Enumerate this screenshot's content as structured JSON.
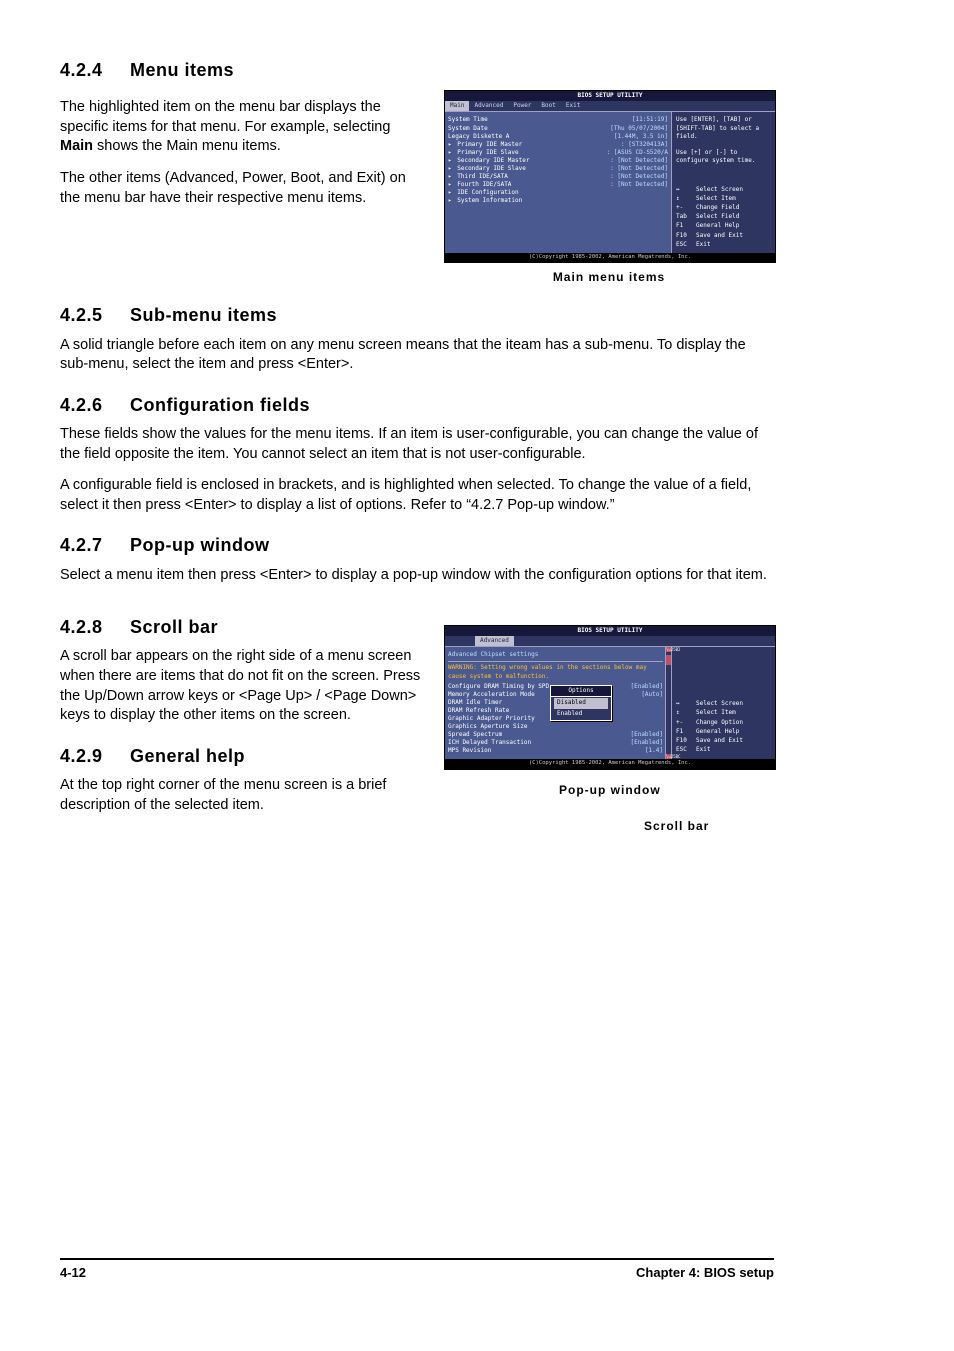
{
  "sections": {
    "s424": {
      "num": "4.2.4",
      "title": "Menu items",
      "p1": "The highlighted item on the menu bar  displays the specific items for that menu. For example, selecting ",
      "p1bold": "Main",
      "p1cont": " shows the Main menu items.",
      "p2": "The other items (Advanced, Power, Boot, and Exit) on the menu bar have their respective menu items.",
      "figcap": "Main menu items"
    },
    "s425": {
      "num": "4.2.5",
      "title": "Sub-menu items",
      "p1": "A solid triangle before each item on any menu screen means that the iteam has a sub-menu. To display the sub-menu, select the item and press <Enter>."
    },
    "s426": {
      "num": "4.2.6",
      "title": "Configuration fields",
      "p1": "These fields show the values for the menu items. If an item is user-configurable, you can change the value of the field opposite the item. You cannot select an item that is not user-configurable.",
      "p2": "A configurable field is enclosed in brackets, and is highlighted when selected. To change the value of a field, select it then press <Enter> to display a list of options. Refer to “4.2.7 Pop-up window.”"
    },
    "s427": {
      "num": "4.2.7",
      "title": "Pop-up window",
      "p1": "Select a menu item then press <Enter> to display a pop-up window with the configuration options for that item."
    },
    "s428": {
      "num": "4.2.8",
      "title": "Scroll bar",
      "p1": "A scroll bar appears on the right side of a menu screen when there are items that do not fit on the screen. Press the Up/Down arrow keys or <Page Up> / <Page Down> keys to display the other items on the screen."
    },
    "s429": {
      "num": "4.2.9",
      "title": "General help",
      "p1": "At the top right corner of the menu screen is a brief description of the selected item."
    }
  },
  "bios1": {
    "title": "BIOS SETUP UTILITY",
    "menu": [
      "Main",
      "Advanced",
      "Power",
      "Boot",
      "Exit"
    ],
    "items": [
      {
        "lbl": "System Time",
        "val": "[11:51:19]",
        "tri": false
      },
      {
        "lbl": "System Date",
        "val": "[Thu 05/07/2004]",
        "tri": false
      },
      {
        "lbl": "Legacy Diskette A",
        "val": "[1.44M, 3.5 in]",
        "tri": false
      },
      {
        "lbl": "",
        "val": "",
        "tri": false
      },
      {
        "lbl": " Primary IDE Master",
        "val": ": [ST320413A]",
        "tri": true
      },
      {
        "lbl": " Primary IDE Slave",
        "val": ": [ASUS CD-S520/A",
        "tri": true
      },
      {
        "lbl": " Secondary IDE Master",
        "val": ": [Not Detected]",
        "tri": true
      },
      {
        "lbl": " Secondary IDE Slave",
        "val": ": [Not Detected]",
        "tri": true
      },
      {
        "lbl": " Third IDE/SATA",
        "val": ": [Not Detected]",
        "tri": true
      },
      {
        "lbl": " Fourth IDE/SATA",
        "val": ": [Not Detected]",
        "tri": true
      },
      {
        "lbl": " IDE Configuration",
        "val": "",
        "tri": true
      },
      {
        "lbl": "",
        "val": "",
        "tri": false
      },
      {
        "lbl": " System Information",
        "val": "",
        "tri": true
      }
    ],
    "help_top": "Use [ENTER], [TAB] or [SHIFT-TAB] to select a field.\n\nUse [+] or [-] to configure system time.",
    "help_keys": [
      [
        "↔",
        "Select Screen"
      ],
      [
        "↕",
        "Select Item"
      ],
      [
        "+-",
        "Change Field"
      ],
      [
        "Tab",
        "Select Field"
      ],
      [
        "F1",
        "General Help"
      ],
      [
        "F10",
        "Save and Exit"
      ],
      [
        "ESC",
        "Exit"
      ]
    ],
    "footer": "(C)Copyright 1985-2002, American Megatrends, Inc."
  },
  "bios2": {
    "title": "BIOS SETUP UTILITY",
    "menu": [
      "Advanced"
    ],
    "heading": "Advanced Chipset settings",
    "warning": "WARNING: Setting wrong values in the sections below may cause system to malfunction.",
    "items": [
      {
        "lbl": "Configure DRAM Timing by SPD",
        "val": "[Enabled]"
      },
      {
        "lbl": "Memory Acceleration Mode",
        "val": "[Auto]"
      },
      {
        "lbl": "DRAM Idle Timer",
        "val": ""
      },
      {
        "lbl": "DRAM Refresh Rate",
        "val": ""
      },
      {
        "lbl": "",
        "val": ""
      },
      {
        "lbl": "Graphic Adapter Priority",
        "val": ""
      },
      {
        "lbl": "Graphics Aperture Size",
        "val": ""
      },
      {
        "lbl": "Spread Spectrum",
        "val": "[Enabled]"
      },
      {
        "lbl": "",
        "val": ""
      },
      {
        "lbl": "ICH Delayed Transaction",
        "val": "[Enabled]"
      },
      {
        "lbl": "",
        "val": ""
      },
      {
        "lbl": "MPS Revision",
        "val": "[1.4]"
      }
    ],
    "popup": {
      "title": "Options",
      "opts": [
        "Disabled",
        "Enabled"
      ],
      "sel": 0
    },
    "help_keys": [
      [
        "↔",
        "Select Screen"
      ],
      [
        "↕",
        "Select Item"
      ],
      [
        "+-",
        "Change Option"
      ],
      [
        "F1",
        "General Help"
      ],
      [
        "F10",
        "Save and Exit"
      ],
      [
        "ESC",
        "Exit"
      ]
    ],
    "footer": "(C)Copyright 1985-2002, American Megatrends, Inc.",
    "callout1": "Pop-up window",
    "callout2": "Scroll bar"
  },
  "footer": {
    "left": "4-12",
    "right": "Chapter 4: BIOS setup"
  }
}
